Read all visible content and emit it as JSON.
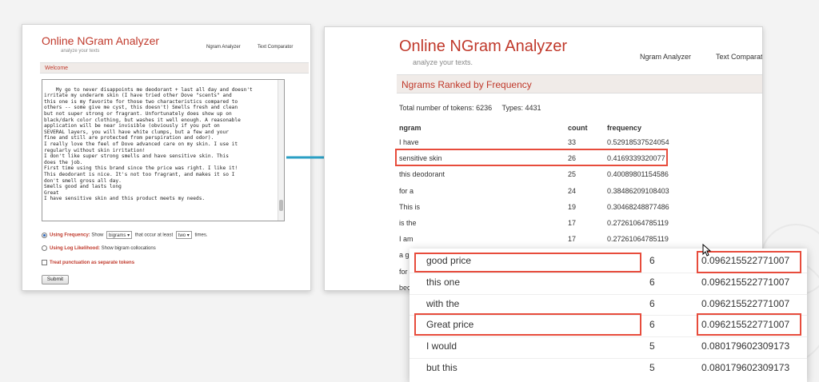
{
  "left_window": {
    "title": "Online NGram Analyzer",
    "subtitle": "analyze your texts",
    "nav": [
      "Ngram Analyzer",
      "Text Comparator"
    ],
    "section": "Welcome",
    "textarea_value": "My go to never disappoints me deodorant + last all day and doesn't\nirritate my underarm skin (I have tried other Dove \"scents\" and\nthis one is my favorite for those two characteristics compared to\nothers -- some give me cyst, this doesn't) Smells fresh and clean\nbut not super strong or fragrant. Unfortunately does show up on\nblack/dark color clothing, but washes it well enough. A reasonable\napplication will be near invisible (obviously if you put on\nSEVERAL layers, you will have white clumps, but a few and your\nfine and still are protected from perspiration and odor).\nI really love the feel of Dove advanced care on my skin. I use it\nregularly without skin irritation!\nI don't like super strong smells and have sensitive skin. This\ndoes the job.\nFirst time using this brand since the price was right. I like it!\nThis deodorant is nice. It's not too fragrant, and makes it so I\ndon't smell gross all day.\nSmells good and lasts long\nGreat\nI have sensitive skin and this product meets my needs.",
    "opt_frequency_label": "Using Frequency:",
    "opt_show": "Show",
    "ngram_select": "bigrams",
    "opt_occur": "that occur at least",
    "min_select": "two",
    "opt_times": "times.",
    "opt_loglik_label": "Using Log Likelihood:",
    "opt_loglik_text": "Show bigram collocations",
    "opt_punct_label": "Treat punctuation as separate tokens",
    "submit": "Submit"
  },
  "right_window": {
    "title": "Online NGram Analyzer",
    "subtitle": "analyze your texts.",
    "nav": [
      "Ngram Analyzer",
      "Text Comparat"
    ],
    "section": "Ngrams Ranked by Frequency",
    "totals_label": "Total number of tokens:",
    "totals_value": "6236",
    "types_label": "Types:",
    "types_value": "4431",
    "headers": [
      "ngram",
      "count",
      "frequency"
    ],
    "rows": [
      {
        "ngram": "I have",
        "count": "33",
        "frequency": "0.52918537524054"
      },
      {
        "ngram": "sensitive skin",
        "count": "26",
        "frequency": "0.4169339320077"
      },
      {
        "ngram": "this deodorant",
        "count": "25",
        "frequency": "0.40089801154586"
      },
      {
        "ngram": "for a",
        "count": "24",
        "frequency": "0.38486209108403"
      },
      {
        "ngram": "This is",
        "count": "19",
        "frequency": "0.30468248877486"
      },
      {
        "ngram": "is the",
        "count": "17",
        "frequency": "0.27261064785119"
      },
      {
        "ngram": "I am",
        "count": "17",
        "frequency": "0.27261064785119"
      },
      {
        "ngram": "a g",
        "count": "",
        "frequency": ""
      },
      {
        "ngram": "for",
        "count": "",
        "frequency": ""
      },
      {
        "ngram": "bec",
        "count": "",
        "frequency": ""
      }
    ]
  },
  "zoom_rows": [
    {
      "ngram": "good price",
      "count": "6",
      "frequency": "0.096215522771007"
    },
    {
      "ngram": "this one",
      "count": "6",
      "frequency": "0.096215522771007"
    },
    {
      "ngram": "with the",
      "count": "6",
      "frequency": "0.096215522771007"
    },
    {
      "ngram": "Great price",
      "count": "6",
      "frequency": "0.096215522771007"
    },
    {
      "ngram": "I would",
      "count": "5",
      "frequency": "0.080179602309173"
    },
    {
      "ngram": "but this",
      "count": "5",
      "frequency": "0.080179602309173"
    }
  ],
  "colors": {
    "brand_red": "#c0392b",
    "highlight": "#e74c3c",
    "arrow": "#2a9fc4"
  }
}
